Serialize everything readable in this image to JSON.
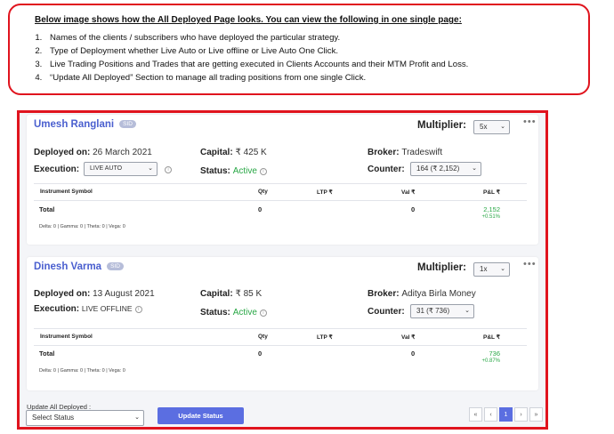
{
  "callout": {
    "headline": "Below image shows how the All Deployed Page looks. You can view the following in one single page:",
    "items": [
      "Names of the clients / subscribers who have deployed the particular strategy.",
      "Type of Deployment whether Live Auto or Live offline or Live Auto One Click.",
      "Live Trading Positions and Trades that are getting executed in Clients Accounts and their MTM Profit and Loss.",
      "“Update All Deployed” Section to manage all trading positions from one single Click."
    ],
    "numbers": [
      "1.",
      "2.",
      "3.",
      "4."
    ]
  },
  "cards": [
    {
      "name": "Umesh Ranglani",
      "sid": "SID",
      "multiplier_label": "Multiplier:",
      "multiplier": "5x",
      "deployed_on_label": "Deployed on:",
      "deployed_on": "26 March 2021",
      "capital_label": "Capital:",
      "capital": "₹ 425 K",
      "broker_label": "Broker:",
      "broker": "Tradeswift",
      "execution_label": "Execution:",
      "execution": "LIVE AUTO",
      "status_label": "Status:",
      "status": "Active",
      "counter_label": "Counter:",
      "counter": "164 (₹ 2,152)",
      "headers": {
        "instrument": "Instrument Symbol",
        "qty": "Qty",
        "ltp": "LTP ₹",
        "val": "Val ₹",
        "pnl": "P&L ₹"
      },
      "total_label": "Total",
      "total_qty": "0",
      "total_val": "0",
      "total_pnl": "2,152",
      "total_pnl_pct": "+0.51%",
      "greeks": "Delta: 0 | Gamma: 0 | Theta: 0 | Vega: 0"
    },
    {
      "name": "Dinesh Varma",
      "sid": "SID",
      "multiplier_label": "Multiplier:",
      "multiplier": "1x",
      "deployed_on_label": "Deployed on:",
      "deployed_on": "13 August 2021",
      "capital_label": "Capital:",
      "capital": "₹ 85 K",
      "broker_label": "Broker:",
      "broker": "Aditya Birla Money",
      "execution_label": "Execution:",
      "execution": "LIVE OFFLINE",
      "status_label": "Status:",
      "status": "Active",
      "counter_label": "Counter:",
      "counter": "31 (₹ 736)",
      "headers": {
        "instrument": "Instrument Symbol",
        "qty": "Qty",
        "ltp": "LTP ₹",
        "val": "Val ₹",
        "pnl": "P&L ₹"
      },
      "total_label": "Total",
      "total_qty": "0",
      "total_val": "0",
      "total_pnl": "736",
      "total_pnl_pct": "+0.87%",
      "greeks": "Delta: 0 | Gamma: 0 | Theta: 0 | Vega: 0"
    }
  ],
  "footer": {
    "update_label": "Update All Deployed :",
    "select_status": "Select Status",
    "update_button": "Update Status",
    "pager": [
      "«",
      "‹",
      "1",
      "›",
      "»"
    ]
  },
  "colors": {
    "frame": "#e0141e",
    "accent": "#5b6ee1",
    "name": "#4a5fcf",
    "positive": "#28a745"
  },
  "icons": {
    "dropdown": "chevron-down-icon",
    "more": "more-dots-icon",
    "info": "info-icon"
  }
}
